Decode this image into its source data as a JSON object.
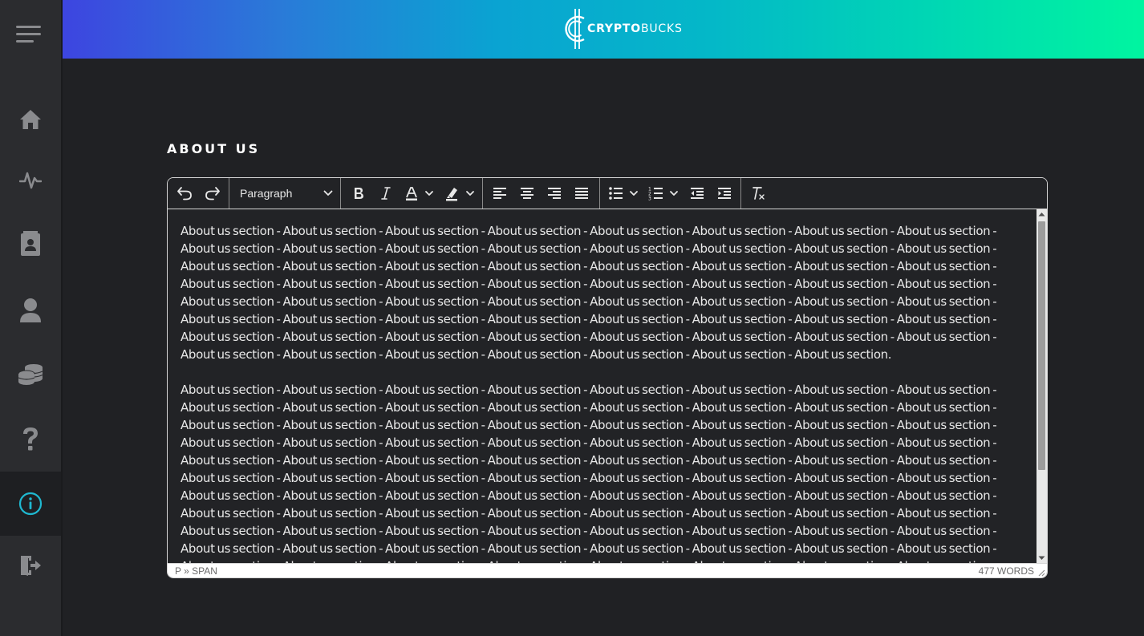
{
  "brand": {
    "name_bold": "CRYPTO",
    "name_light": "BUCKS"
  },
  "sidebar": {
    "items": [
      {
        "icon": "home-icon",
        "active": false
      },
      {
        "icon": "activity-icon",
        "active": false
      },
      {
        "icon": "contacts-book-icon",
        "active": false
      },
      {
        "icon": "user-icon",
        "active": false
      },
      {
        "icon": "coins-icon",
        "active": false
      },
      {
        "icon": "question-icon",
        "active": false
      },
      {
        "icon": "info-icon",
        "active": true
      },
      {
        "icon": "logout-icon",
        "active": false
      }
    ],
    "active_color": "#1fb8d0"
  },
  "page": {
    "title": "ABOUT US"
  },
  "editor": {
    "toolbar": {
      "block_format": "Paragraph",
      "buttons": [
        "undo-icon",
        "redo-icon",
        "bold-icon",
        "italic-icon",
        "text-color-icon",
        "highlight-icon",
        "align-left-icon",
        "align-center-icon",
        "align-right-icon",
        "justify-icon",
        "bullet-list-icon",
        "numbered-list-icon",
        "outdent-icon",
        "indent-icon",
        "clear-formatting-icon"
      ]
    },
    "paragraphs": [
      "About us section - About us section - About us section - About us section - About us section - About us section - About us section - About us section - About us section - About us section - About us section - About us section - About us section - About us section - About us section - About us section - About us section - About us section - About us section - About us section - About us section - About us section - About us section - About us section - About us section - About us section - About us section - About us section - About us section - About us section - About us section - About us section - About us section - About us section - About us section - About us section - About us section - About us section - About us section - About us section - About us section - About us section - About us section - About us section - About us section - About us section - About us section - About us section - About us section - About us section - About us section - About us section - About us section - About us section - About us section - About us section - About us section - About us section - About us section - About us section - About us section - About us section - About us section.",
      "About us section - About us section - About us section - About us section - About us section - About us section - About us section - About us section - About us section - About us section - About us section - About us section - About us section - About us section - About us section - About us section - About us section - About us section - About us section - About us section - About us section - About us section - About us section - About us section - About us section - About us section - About us section - About us section - About us section - About us section - About us section - About us section - About us section - About us section - About us section - About us section - About us section - About us section - About us section - About us section - About us section - About us section - About us section - About us section - About us section - About us section - About us section - About us section - About us section - About us section - About us section - About us section - About us section - About us section - About us section - About us section - About us section - About us section - About us section - About us section - About us section - About us section - About us section - About us section - About us section - About us section - About us section - About us section - About us section - About us section - About us section - About us section - About us section - About us section - About us section - About us section - About us section - About us section - About us section - About us section - About us section - About us section - About us section - About us section - About us section - About us section - About us section - About us section - About us section - About us section - About us section - About us section - About us section - About us section."
    ],
    "status": {
      "path": "P » SPAN",
      "words": "477 WORDS"
    }
  }
}
